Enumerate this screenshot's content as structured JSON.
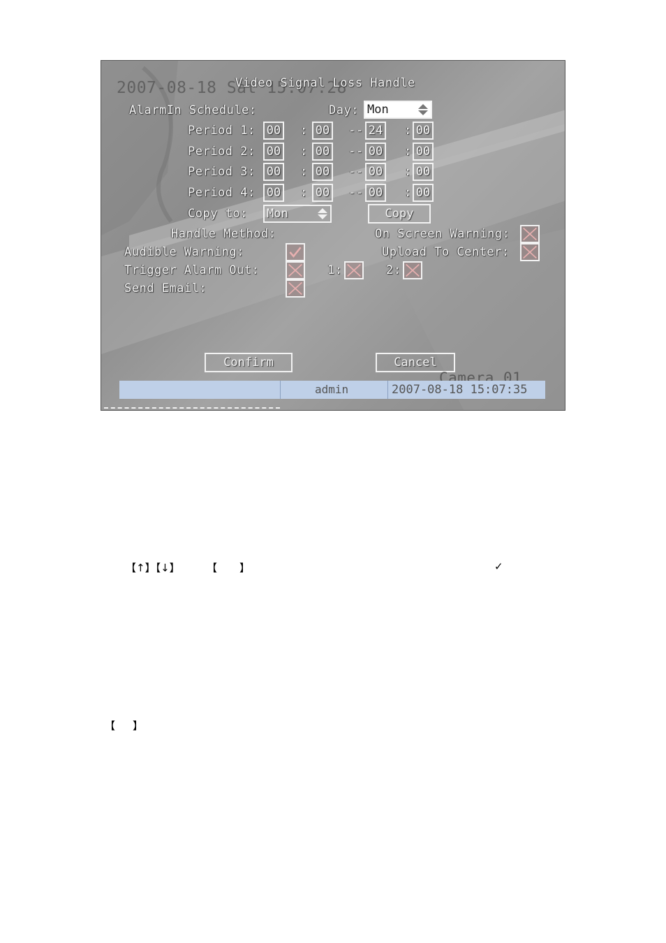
{
  "screen": {
    "osd_datetime": "2007-08-18 Sat 15:07:28",
    "title": "Video Signal Loss Handle",
    "camera_label": "Camera 01",
    "schedule_label": "AlarmIn Schedule:",
    "day_label": "Day:",
    "day_value": "Mon",
    "periods": [
      {
        "label": "Period 1:",
        "start_h": "00",
        "start_m": "00",
        "end_h": "24",
        "end_m": "00"
      },
      {
        "label": "Period 2:",
        "start_h": "00",
        "start_m": "00",
        "end_h": "00",
        "end_m": "00"
      },
      {
        "label": "Period 3:",
        "start_h": "00",
        "start_m": "00",
        "end_h": "00",
        "end_m": "00"
      },
      {
        "label": "Period 4:",
        "start_h": "00",
        "start_m": "00",
        "end_h": "00",
        "end_m": "00"
      }
    ],
    "colon": ":",
    "dash": "--",
    "copy_to_label": "Copy to:",
    "copy_to_value": "Mon",
    "copy_button": "Copy",
    "handle_method_label": "Handle Method:",
    "on_screen_warning_label": "On Screen Warning:",
    "audible_warning_label": "Audible Warning:",
    "upload_to_center_label": "Upload To Center:",
    "trigger_alarm_out_label": "Trigger Alarm Out:",
    "alarm_out_1_label": "1:",
    "alarm_out_2_label": "2:",
    "send_email_label": "Send Email:",
    "confirm_button": "Confirm",
    "cancel_button": "Cancel",
    "status_user": "admin",
    "status_datetime": "2007-08-18 15:07:35"
  },
  "doc": {
    "keys_text": "【↑】【↓】",
    "bracket_left": "【",
    "bracket_right": "】",
    "checkmark": "✓",
    "bracket2_left": "【",
    "bracket2_right": "】"
  }
}
